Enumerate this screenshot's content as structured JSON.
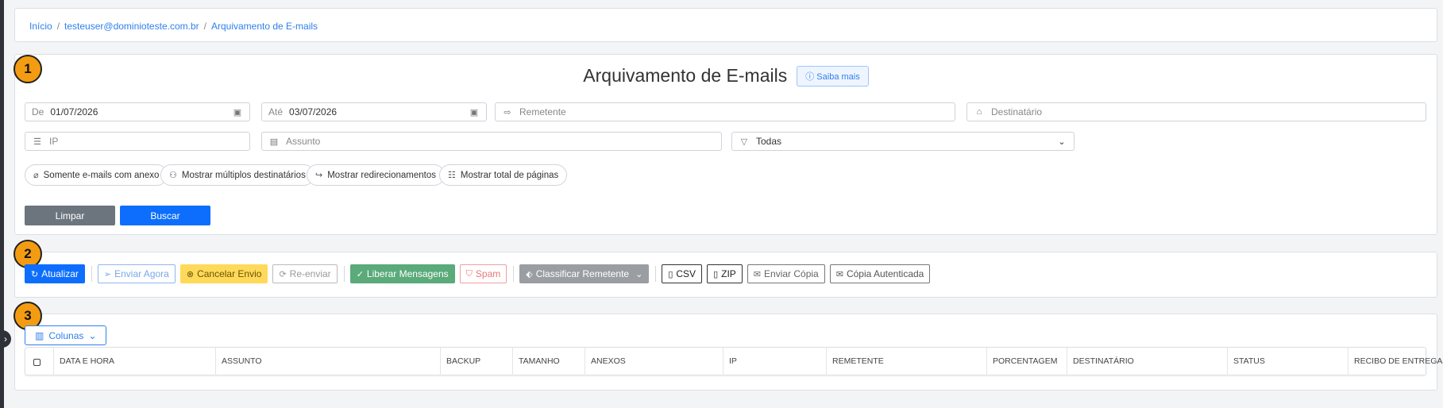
{
  "breadcrumb": [
    "Início",
    "testeuser@dominioteste.com.br",
    "Arquivamento de E-mails"
  ],
  "sections": {
    "one": "1",
    "two": "2",
    "three": "3"
  },
  "header": {
    "title": "Arquivamento de E-mails",
    "saiba_mais": "Saiba mais"
  },
  "filters": {
    "de_label": "De",
    "de_value": "01/07/2026",
    "ate_label": "Até",
    "ate_value": "03/07/2026",
    "remetente_placeholder": "Remetente",
    "destinatario_placeholder": "Destinatário",
    "ip_placeholder": "IP",
    "assunto_placeholder": "Assunto",
    "status_value": "Todas"
  },
  "toggles": [
    "Somente e-mails com anexo",
    "Mostrar múltiplos destinatários",
    "Mostrar redirecionamentos",
    "Mostrar total de páginas"
  ],
  "actions": {
    "limpar": "Limpar",
    "buscar": "Buscar"
  },
  "toolbar": {
    "atualizar": "Atualizar",
    "enviar_agora": "Enviar Agora",
    "cancelar_envio": "Cancelar Envio",
    "reenviar": "Re-enviar",
    "liberar": "Liberar Mensagens",
    "spam": "Spam",
    "classificar": "Classificar Remetente",
    "csv": "CSV",
    "zip": "ZIP",
    "enviar_copia": "Enviar Cópia",
    "copia_autenticada": "Cópia Autenticada"
  },
  "table": {
    "colunas_button": "Colunas",
    "columns": [
      "DATA E HORA",
      "ASSUNTO",
      "BACKUP",
      "TAMANHO",
      "ANEXOS",
      "IP",
      "REMETENTE",
      "PORCENTAGEM",
      "DESTINATÁRIO",
      "STATUS",
      "RECIBO DE ENTREGA"
    ]
  },
  "colors": {
    "primary": "#0d6efd",
    "secondary": "#6c757d",
    "warning": "#ffd95a",
    "success": "#5aaa7a",
    "badge": "#f39c12"
  }
}
